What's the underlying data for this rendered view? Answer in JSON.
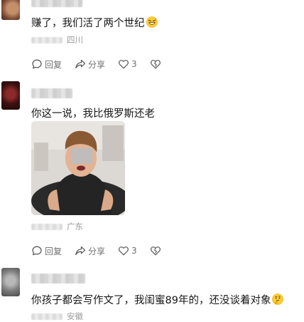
{
  "comments": [
    {
      "text": "赚了，我们活了两个世纪",
      "location": "四川",
      "actions": {
        "reply": "回复",
        "share": "分享",
        "likes": "3"
      }
    },
    {
      "text": "你这一说，我比俄罗斯还老",
      "location": "广东",
      "actions": {
        "reply": "回复",
        "share": "分享",
        "likes": "3"
      }
    },
    {
      "text": "你孩子都会写作文了，我闺蜜89年的，还没谈着对象",
      "location": "安徽"
    }
  ],
  "icons": {
    "reply": "reply-bubble-icon",
    "share": "share-arrow-icon",
    "like": "heart-icon",
    "dislike": "broken-heart-icon"
  },
  "colors": {
    "text": "#161616",
    "meta": "#9a9a9a",
    "action": "#6f6f6f"
  }
}
